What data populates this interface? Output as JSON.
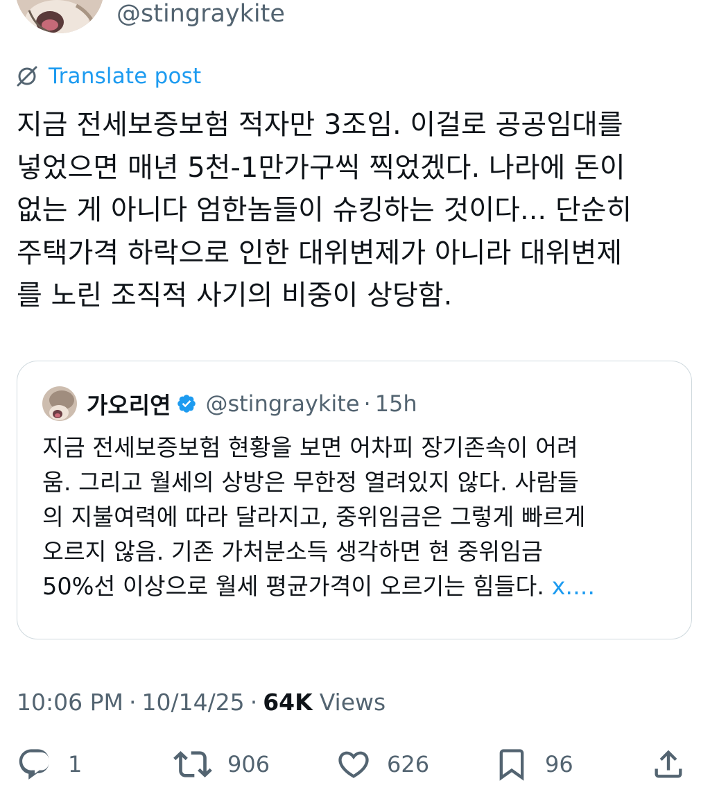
{
  "author": {
    "handle": "@stingraykite"
  },
  "translate": {
    "label": "Translate post",
    "icon": "translate-icon"
  },
  "post": {
    "lines": [
      "지금 전세보증보험 적자만 3조임. 이걸로 공공임대를",
      "넣었으면 매년 5천-1만가구씩 찍었겠다. 나라에 돈이",
      "없는 게 아니다 엄한놈들이 슈킹하는 것이다... 단순히",
      "주택가격 하락으로 인한 대위변제가 아니라 대위변제",
      "를 노린 조직적 사기의 비중이 상당함."
    ]
  },
  "quote": {
    "name": "가오리연",
    "handle": "@stingraykite",
    "dot": "·",
    "time": "15h",
    "lines": [
      "지금 전세보증보험 현황을 보면 어차피 장기존속이 어려",
      "움. 그리고 월세의 상방은 무한정 열려있지 않다. 사람들",
      "의 지불여력에 따라 달라지고, 중위임금은 그렇게 빠르게",
      "오르지 않음. 기존 가처분소득 생각하면 현 중위임금",
      "50%선 이상으로 월세 평균가격이 오르기는 힘들다. "
    ],
    "show_more": "x...."
  },
  "meta": {
    "time": "10:06 PM",
    "sep1": "·",
    "date": "10/14/25",
    "sep2": "·",
    "views_count": "64K",
    "views_label": "Views"
  },
  "actions": {
    "reply": "1",
    "repost": "906",
    "like": "626",
    "bookmark": "96"
  },
  "colors": {
    "accent": "#1d9bf0",
    "text": "#0f1419",
    "secondary": "#536471",
    "border": "#cfd9de"
  }
}
